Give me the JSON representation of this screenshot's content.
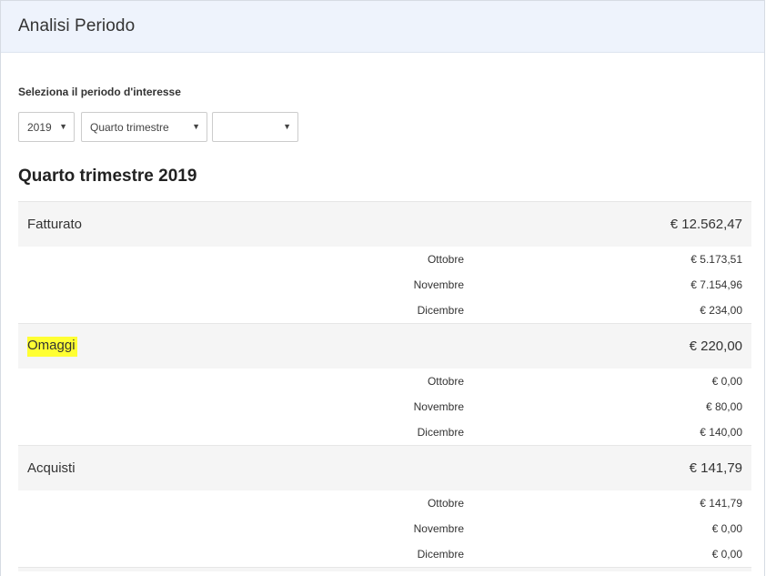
{
  "header": {
    "title": "Analisi Periodo"
  },
  "filter": {
    "label": "Seleziona il periodo d'interesse",
    "year": "2019",
    "period": "Quarto trimestre",
    "month": ""
  },
  "section": {
    "title": "Quarto trimestre 2019"
  },
  "groups": [
    {
      "label": "Fatturato",
      "total": "€ 12.562,47",
      "months": [
        {
          "label": "Ottobre",
          "value": "€ 5.173,51"
        },
        {
          "label": "Novembre",
          "value": "€ 7.154,96"
        },
        {
          "label": "Dicembre",
          "value": "€ 234,00"
        }
      ]
    },
    {
      "label": "Omaggi",
      "total": "€ 220,00",
      "highlight_color": "#ffff33",
      "months": [
        {
          "label": "Ottobre",
          "value": "€ 0,00"
        },
        {
          "label": "Novembre",
          "value": "€ 80,00"
        },
        {
          "label": "Dicembre",
          "value": "€ 140,00"
        }
      ]
    },
    {
      "label": "Acquisti",
      "total": "€ 141,79",
      "months": [
        {
          "label": "Ottobre",
          "value": "€ 141,79"
        },
        {
          "label": "Novembre",
          "value": "€ 0,00"
        },
        {
          "label": "Dicembre",
          "value": "€ 0,00"
        }
      ]
    }
  ],
  "icons": {
    "select_arrow": "caret-down-icon"
  }
}
